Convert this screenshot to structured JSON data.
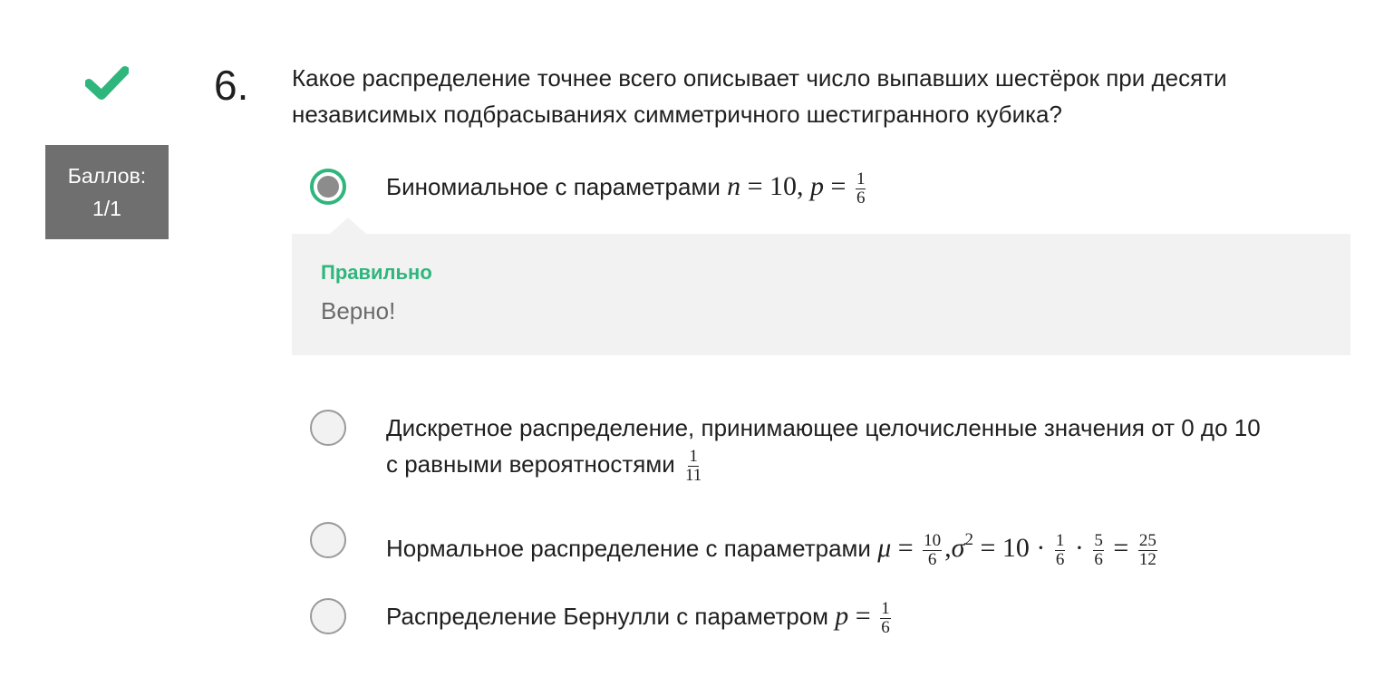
{
  "colors": {
    "accent_green": "#2eb67d",
    "score_bg": "#6f6f6f",
    "feedback_bg": "#f2f2f2"
  },
  "status": {
    "icon": "checkmark-icon",
    "score_label": "Баллов:",
    "score_value": "1/1"
  },
  "question": {
    "number": "6.",
    "text": "Какое распределение точнее всего описывает число выпавших шестёрок при десяти независимых подбрасываниях симметричного шестигранного кубика?"
  },
  "options": [
    {
      "selected": true,
      "text": "Биномиальное с параметрами",
      "math": {
        "n_var": "n",
        "eq": "=",
        "n_val": "10",
        "comma": ",",
        "p_var": "p",
        "p_num": "1",
        "p_den": "6"
      }
    },
    {
      "selected": false,
      "text_line1": "Дискретное распределение, принимающее целочисленные значения от 0 до 10",
      "text_line2": "с равными вероятностями",
      "math": {
        "num": "1",
        "den": "11"
      }
    },
    {
      "selected": false,
      "text": "Нормальное распределение с параметрами",
      "math": {
        "mu": "μ",
        "eq": "=",
        "mu_num": "10",
        "mu_den": "6",
        "comma": ",",
        "sigma": "σ",
        "sigma_exp": "2",
        "ten": "10",
        "dot": "·",
        "f1_num": "1",
        "f1_den": "6",
        "f2_num": "5",
        "f2_den": "6",
        "res_num": "25",
        "res_den": "12"
      }
    },
    {
      "selected": false,
      "text": "Распределение Бернулли с параметром",
      "math": {
        "p_var": "p",
        "eq": "=",
        "p_num": "1",
        "p_den": "6"
      }
    }
  ],
  "feedback": {
    "title": "Правильно",
    "text": "Верно!"
  }
}
